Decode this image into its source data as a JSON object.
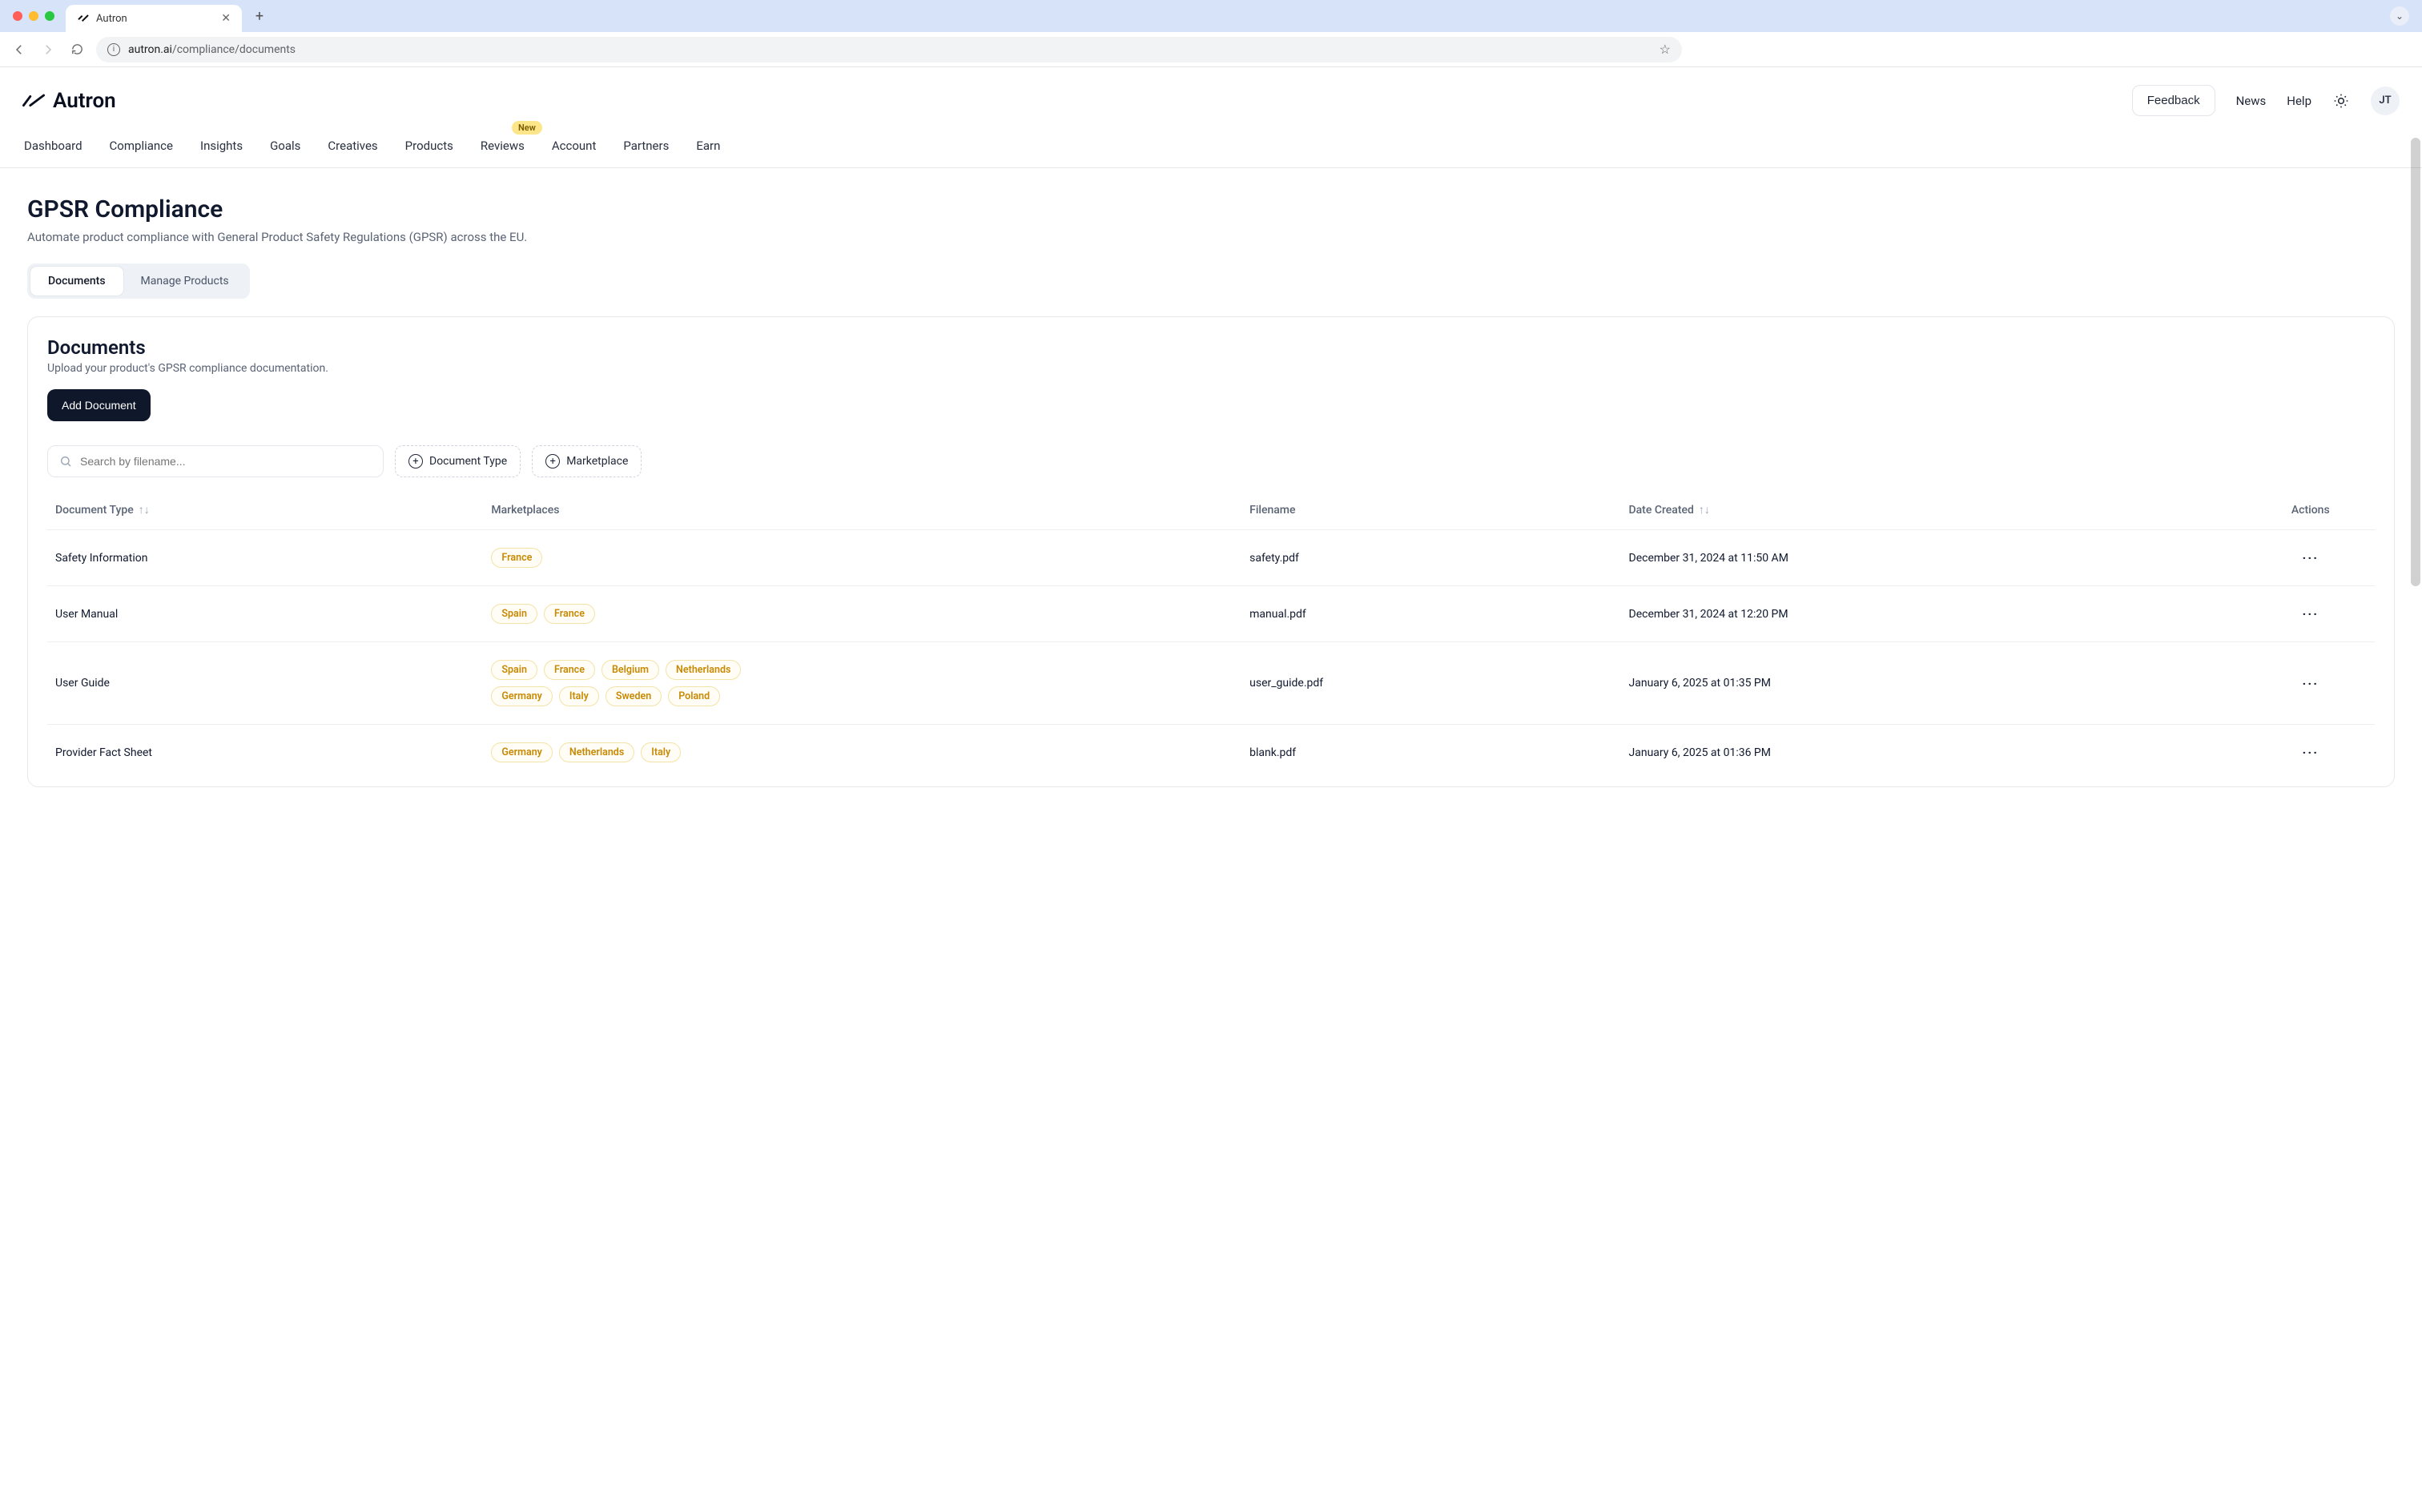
{
  "browser": {
    "tab_title": "Autron",
    "url_host": "autron.ai",
    "url_path": "/compliance/documents"
  },
  "header": {
    "brand": "Autron",
    "feedback": "Feedback",
    "news": "News",
    "help": "Help",
    "avatar_initials": "JT"
  },
  "nav": {
    "items": [
      "Dashboard",
      "Compliance",
      "Insights",
      "Goals",
      "Creatives",
      "Products",
      "Reviews",
      "Account",
      "Partners",
      "Earn"
    ],
    "badge_index": 6,
    "badge_text": "New"
  },
  "page": {
    "title": "GPSR Compliance",
    "subtitle": "Automate product compliance with General Product Safety Regulations (GPSR) across the EU."
  },
  "tabs": {
    "documents": "Documents",
    "manage": "Manage Products",
    "active": "documents"
  },
  "card": {
    "title": "Documents",
    "desc": "Upload your product's GPSR compliance documentation.",
    "add_button": "Add Document",
    "search_placeholder": "Search by filename...",
    "filter_doc_type": "Document Type",
    "filter_marketplace": "Marketplace"
  },
  "table": {
    "columns": {
      "doc_type": "Document Type",
      "marketplaces": "Marketplaces",
      "filename": "Filename",
      "date_created": "Date Created",
      "actions": "Actions"
    },
    "rows": [
      {
        "doc_type": "Safety Information",
        "marketplaces": [
          "France"
        ],
        "filename": "safety.pdf",
        "date": "December 31, 2024 at 11:50 AM"
      },
      {
        "doc_type": "User Manual",
        "marketplaces": [
          "Spain",
          "France"
        ],
        "filename": "manual.pdf",
        "date": "December 31, 2024 at 12:20 PM"
      },
      {
        "doc_type": "User Guide",
        "marketplaces": [
          "Spain",
          "France",
          "Belgium",
          "Netherlands",
          "Germany",
          "Italy",
          "Sweden",
          "Poland"
        ],
        "filename": "user_guide.pdf",
        "date": "January 6, 2025 at 01:35 PM"
      },
      {
        "doc_type": "Provider Fact Sheet",
        "marketplaces": [
          "Germany",
          "Netherlands",
          "Italy"
        ],
        "filename": "blank.pdf",
        "date": "January 6, 2025 at 01:36 PM"
      }
    ]
  }
}
